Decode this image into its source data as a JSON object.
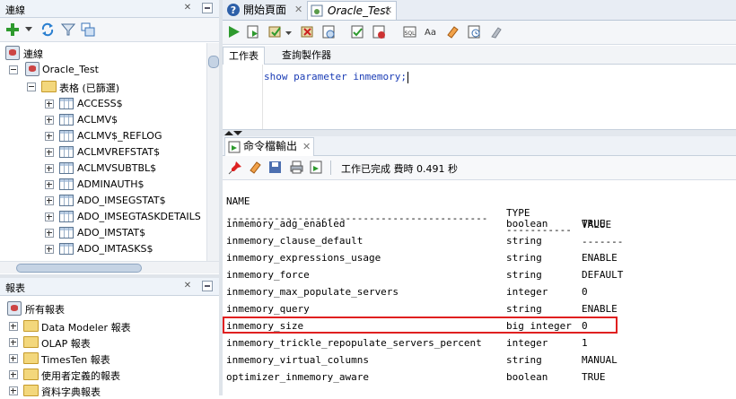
{
  "connections_panel": {
    "title": "連線"
  },
  "tree": {
    "root": "連線",
    "connection": "Oracle_Test",
    "tables_folder": "表格 (已篩選)",
    "tables": [
      "ACCESS$",
      "ACLMV$",
      "ACLMV$_REFLOG",
      "ACLMVREFSTAT$",
      "ACLMVSUBTBL$",
      "ADMINAUTH$",
      "ADO_IMSEGSTAT$",
      "ADO_IMSEGTASKDETAILS",
      "ADO_IMSTAT$",
      "ADO_IMTASKS$"
    ]
  },
  "reports_panel": {
    "title": "報表",
    "root": "所有報表",
    "items": [
      "Data Modeler 報表",
      "OLAP 報表",
      "TimesTen 報表",
      "使用者定義的報表",
      "資料字典報表"
    ]
  },
  "editor_tabs": [
    {
      "label": "開始頁面"
    },
    {
      "label": "Oracle_Test"
    }
  ],
  "sub_tabs": [
    "工作表",
    "查詢製作器"
  ],
  "editor": {
    "code": "show parameter inmemory;"
  },
  "output": {
    "tab_label": "命令檔輸出",
    "status": "工作已完成 費時 0.491 秒",
    "header": {
      "name": "NAME",
      "type": "TYPE",
      "value": "VALUE"
    },
    "divider": {
      "name": "--------------------------------------------",
      "type": "-----------",
      "value": "-------"
    },
    "rows": [
      {
        "name": "inmemory_adg_enabled",
        "type": "boolean",
        "value": "TRUE"
      },
      {
        "name": "inmemory_clause_default",
        "type": "string",
        "value": ""
      },
      {
        "name": "inmemory_expressions_usage",
        "type": "string",
        "value": "ENABLE"
      },
      {
        "name": "inmemory_force",
        "type": "string",
        "value": "DEFAULT"
      },
      {
        "name": "inmemory_max_populate_servers",
        "type": "integer",
        "value": "0"
      },
      {
        "name": "inmemory_query",
        "type": "string",
        "value": "ENABLE"
      },
      {
        "name": "inmemory_size",
        "type": "big integer",
        "value": "0"
      },
      {
        "name": "inmemory_trickle_repopulate_servers_percent",
        "type": "integer",
        "value": "1"
      },
      {
        "name": "inmemory_virtual_columns",
        "type": "string",
        "value": "MANUAL"
      },
      {
        "name": "optimizer_inmemory_aware",
        "type": "boolean",
        "value": "TRUE"
      }
    ]
  },
  "icons": {
    "toolbar_left": [
      "add-icon",
      "dropdown-arrow-icon",
      "refresh-icon",
      "filter-icon",
      "schema-browser-icon"
    ],
    "toolbar_right": [
      "run-statement-icon",
      "run-script-icon",
      "commit-icon",
      "rollback-icon",
      "autotrace-icon",
      "explain-plan-icon",
      "sql-tuning-icon",
      "format-icon",
      "clear-icon",
      "history-icon",
      "unshared-icon"
    ],
    "output_toolbar": [
      "pin-icon",
      "eraser-icon",
      "save-icon",
      "print-icon",
      "save-file-icon"
    ]
  },
  "colors": {
    "highlight_box": "#e02020",
    "code_text": "#1a3cb5"
  }
}
